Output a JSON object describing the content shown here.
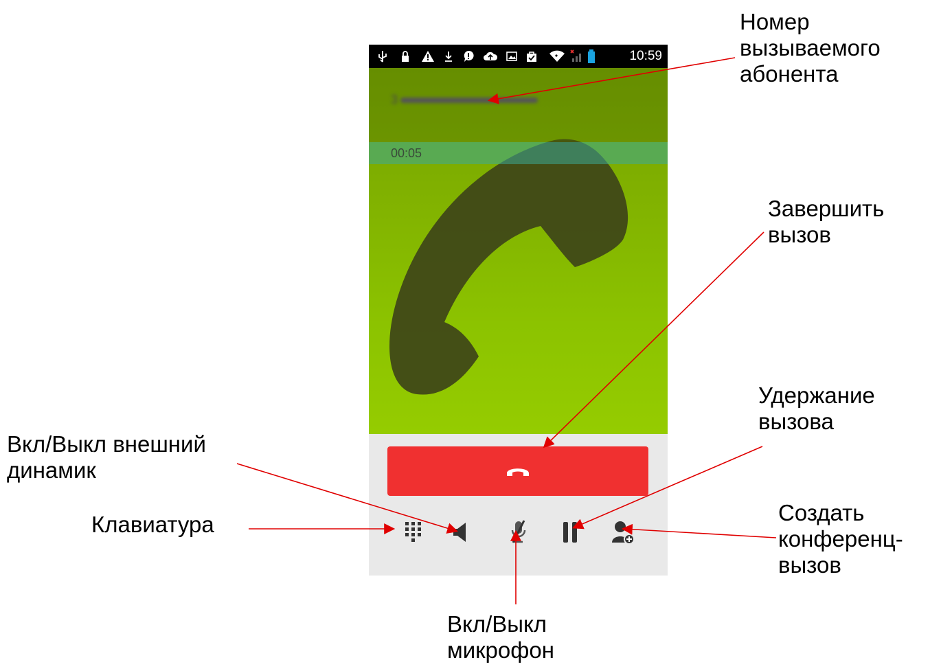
{
  "statusbar": {
    "time": "10:59",
    "icons": [
      "usb-icon",
      "lock-icon",
      "warning-icon",
      "download-icon",
      "alert-icon",
      "cloud-icon",
      "image-icon",
      "bag-icon",
      "wifi-icon",
      "signal-icon",
      "battery-icon"
    ]
  },
  "call": {
    "number": "3",
    "duration": "00:05"
  },
  "controls": [
    "dialpad-icon",
    "speaker-icon",
    "mute-mic-icon",
    "pause-icon",
    "add-participant-icon"
  ],
  "colors": {
    "end_call": "#f03030",
    "arrow": "#e00000"
  },
  "annotations": {
    "caller_number": "Номер\nвызываемого\nабонента",
    "end_call": "Завершить\nвызов",
    "hold": "Удержание\nвызова",
    "speaker": "Вкл/Выкл внешний\nдинамик",
    "keypad": "Клавиатура",
    "conference": "Создать\nконференц-\nвызов",
    "mute": "Вкл/Выкл\nмикрофон"
  }
}
